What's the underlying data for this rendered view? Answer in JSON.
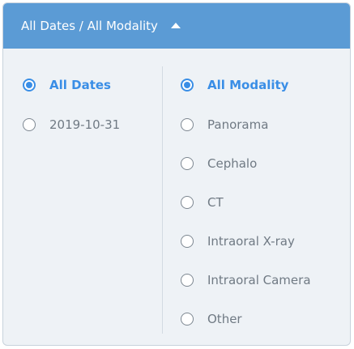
{
  "header": {
    "title": "All Dates / All Modality",
    "caret_icon": "caret-up-icon"
  },
  "dates": {
    "options": [
      {
        "label": "All Dates",
        "selected": true
      },
      {
        "label": "2019-10-31",
        "selected": false
      }
    ]
  },
  "modality": {
    "options": [
      {
        "label": "All Modality",
        "selected": true
      },
      {
        "label": "Panorama",
        "selected": false
      },
      {
        "label": "Cephalo",
        "selected": false
      },
      {
        "label": "CT",
        "selected": false
      },
      {
        "label": "Intraoral X-ray",
        "selected": false
      },
      {
        "label": "Intraoral Camera",
        "selected": false
      },
      {
        "label": "Other",
        "selected": false
      }
    ]
  },
  "colors": {
    "header_bg": "#5b9bd5",
    "accent": "#3a8ee6",
    "panel_bg": "#eef2f6"
  }
}
